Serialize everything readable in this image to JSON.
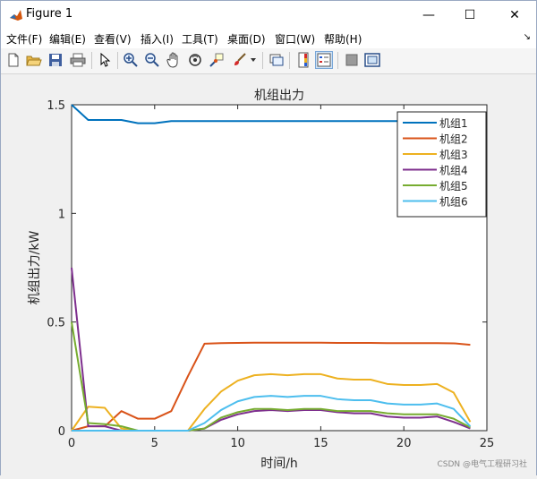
{
  "window": {
    "title": "Figure 1",
    "minimize_glyph": "—",
    "maximize_glyph": "☐",
    "close_glyph": "✕"
  },
  "menu": {
    "items": [
      "文件(F)",
      "编辑(E)",
      "查看(V)",
      "插入(I)",
      "工具(T)",
      "桌面(D)",
      "窗口(W)",
      "帮助(H)"
    ],
    "dock_arrow": "↘"
  },
  "toolbar": {
    "icons": [
      "new-figure-icon",
      "open-file-icon",
      "save-icon",
      "print-icon",
      "pointer-icon",
      "zoom-in-icon",
      "zoom-out-icon",
      "pan-icon",
      "rotate-3d-icon",
      "data-cursor-icon",
      "brush-icon",
      "brush-dropdown-icon",
      "link-plot-icon",
      "insert-colorbar-icon",
      "insert-legend-icon",
      "hide-plot-tools-icon",
      "show-plot-tools-icon"
    ]
  },
  "colors": {
    "s1": "#0072BD",
    "s2": "#D95319",
    "s3": "#EDB120",
    "s4": "#7E2F8E",
    "s5": "#77AC30",
    "s6": "#4DBEEE"
  },
  "chart_data": {
    "type": "line",
    "title": "机组出力",
    "xlabel": "时间/h",
    "ylabel": "机组出力/kW",
    "xlim": [
      0,
      25
    ],
    "ylim": [
      0,
      1.5
    ],
    "xticks": [
      0,
      5,
      10,
      15,
      20,
      25
    ],
    "yticks": [
      0,
      0.5,
      1,
      1.5
    ],
    "ytick_labels": [
      "0",
      "0.5",
      "1",
      "1.5"
    ],
    "grid": false,
    "legend_position": "top-right",
    "x": [
      0,
      1,
      2,
      3,
      4,
      5,
      6,
      7,
      8,
      9,
      10,
      11,
      12,
      13,
      14,
      15,
      16,
      17,
      18,
      19,
      20,
      21,
      22,
      23,
      24
    ],
    "series": [
      {
        "name": "机组1",
        "color": "#0072BD",
        "values": [
          1.5,
          1.43,
          1.43,
          1.43,
          1.415,
          1.415,
          1.425,
          1.425,
          1.425,
          1.425,
          1.425,
          1.425,
          1.425,
          1.425,
          1.425,
          1.425,
          1.425,
          1.425,
          1.425,
          1.425,
          1.425,
          1.425,
          1.425,
          1.425,
          1.425
        ]
      },
      {
        "name": "机组2",
        "color": "#D95319",
        "values": [
          0,
          0.02,
          0.02,
          0.09,
          0.055,
          0.055,
          0.09,
          0.25,
          0.4,
          0.403,
          0.404,
          0.405,
          0.405,
          0.405,
          0.405,
          0.405,
          0.404,
          0.404,
          0.404,
          0.403,
          0.403,
          0.403,
          0.403,
          0.402,
          0.395
        ]
      },
      {
        "name": "机组3",
        "color": "#EDB120",
        "values": [
          0,
          0.11,
          0.105,
          0.01,
          0,
          0,
          0,
          0,
          0.1,
          0.18,
          0.23,
          0.255,
          0.26,
          0.255,
          0.26,
          0.26,
          0.24,
          0.235,
          0.235,
          0.215,
          0.21,
          0.21,
          0.215,
          0.175,
          0.04
        ]
      },
      {
        "name": "机组4",
        "color": "#7E2F8E",
        "values": [
          0.75,
          0.02,
          0.02,
          0,
          0,
          0,
          0,
          0,
          0.01,
          0.05,
          0.075,
          0.09,
          0.095,
          0.09,
          0.095,
          0.095,
          0.085,
          0.08,
          0.08,
          0.065,
          0.06,
          0.06,
          0.065,
          0.04,
          0.01
        ]
      },
      {
        "name": "机组5",
        "color": "#77AC30",
        "values": [
          0.5,
          0.035,
          0.03,
          0.02,
          0,
          0,
          0,
          0,
          0.01,
          0.06,
          0.085,
          0.1,
          0.1,
          0.095,
          0.1,
          0.1,
          0.09,
          0.09,
          0.09,
          0.08,
          0.075,
          0.075,
          0.075,
          0.055,
          0.015
        ]
      },
      {
        "name": "机组6",
        "color": "#4DBEEE",
        "values": [
          0,
          0,
          0,
          0,
          0,
          0,
          0,
          0,
          0.035,
          0.095,
          0.135,
          0.155,
          0.16,
          0.155,
          0.16,
          0.16,
          0.145,
          0.14,
          0.14,
          0.125,
          0.12,
          0.12,
          0.125,
          0.1,
          0.02
        ]
      }
    ]
  },
  "watermark": "CSDN @电气工程研习社"
}
